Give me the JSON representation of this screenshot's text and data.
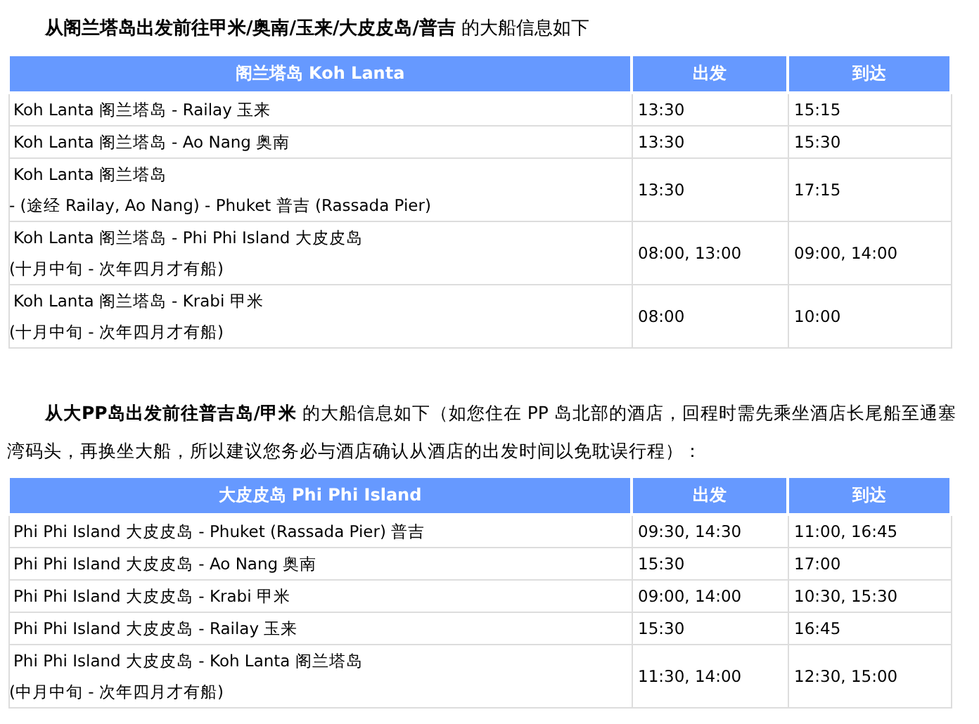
{
  "sections": [
    {
      "intro": "**从阁兰塔岛出发前往甲米/奥南/玉来/大皮皮岛/普吉** 的大船信息如下",
      "table": {
        "columns": [
          "阁兰塔岛 Koh Lanta",
          "出发",
          "到达"
        ],
        "rows": [
          {
            "route": [
              "Koh Lanta 阁兰塔岛 - Railay 玉来"
            ],
            "depart": "13:30",
            "arrive": "15:15"
          },
          {
            "route": [
              "Koh Lanta 阁兰塔岛 - Ao Nang 奥南"
            ],
            "depart": "13:30",
            "arrive": "15:30"
          },
          {
            "route": [
              "Koh Lanta 阁兰塔岛",
              "- (途经 Railay, Ao Nang) - Phuket 普吉 (Rassada Pier)"
            ],
            "depart": "13:30",
            "arrive": "17:15"
          },
          {
            "route": [
              "Koh Lanta 阁兰塔岛 - Phi Phi Island 大皮皮岛",
              "(十月中旬 - 次年四月才有船)"
            ],
            "depart": "08:00, 13:00",
            "arrive": "09:00, 14:00"
          },
          {
            "route": [
              "Koh Lanta 阁兰塔岛 - Krabi 甲米",
              "(十月中旬 - 次年四月才有船)"
            ],
            "depart": "08:00",
            "arrive": "10:00"
          }
        ]
      }
    },
    {
      "intro": "**从大PP岛出发前往普吉岛/甲米** 的大船信息如下（如您住在 PP 岛北部的酒店，回程时需先乘坐酒店长尾船至通塞湾码头，再换坐大船，所以建议您务必与酒店确认从酒店的出发时间以免耽误行程）：",
      "table": {
        "columns": [
          "大皮皮岛 Phi Phi Island",
          "出发",
          "到达"
        ],
        "rows": [
          {
            "route": [
              "Phi Phi Island 大皮皮岛 - Phuket (Rassada Pier) 普吉"
            ],
            "depart": "09:30, 14:30",
            "arrive": "11:00, 16:45"
          },
          {
            "route": [
              "Phi Phi Island 大皮皮岛 - Ao Nang 奥南"
            ],
            "depart": "15:30",
            "arrive": "17:00"
          },
          {
            "route": [
              "Phi Phi Island 大皮皮岛 - Krabi 甲米"
            ],
            "depart": "09:00, 14:00",
            "arrive": "10:30, 15:30"
          },
          {
            "route": [
              "Phi Phi Island 大皮皮岛 - Railay 玉来"
            ],
            "depart": "15:30",
            "arrive": "16:45"
          },
          {
            "route": [
              "Phi Phi Island 大皮皮岛 - Koh Lanta 阁兰塔岛",
              "(中月中旬 - 次年四月才有船)"
            ],
            "depart": "11:30, 14:00",
            "arrive": "12:30, 15:00"
          }
        ]
      }
    }
  ]
}
